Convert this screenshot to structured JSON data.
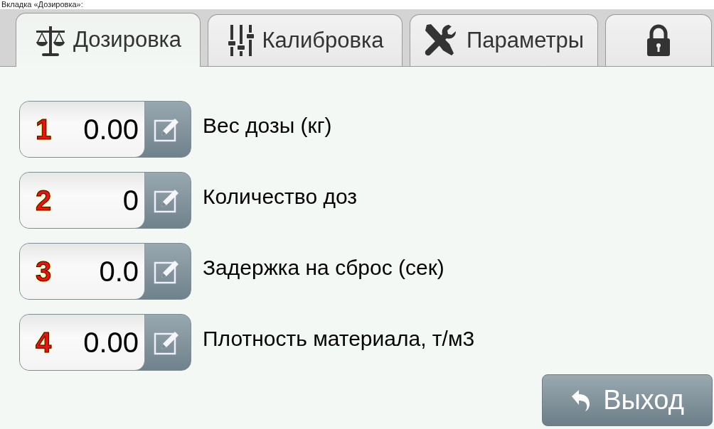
{
  "caption": "Вкладка «Дозировка»:",
  "tabs": [
    {
      "label": "Дозировка",
      "selected": true
    },
    {
      "label": "Калибровка",
      "selected": false
    },
    {
      "label": "Параметры",
      "selected": false
    },
    {
      "selected": false
    }
  ],
  "fields": [
    {
      "number": "1",
      "value": "0.00",
      "label": "Вес дозы (кг)"
    },
    {
      "number": "2",
      "value": "0",
      "label": "Количество доз"
    },
    {
      "number": "3",
      "value": "0.0",
      "label": "Задержка на сброс (сек)"
    },
    {
      "number": "4",
      "value": "0.00",
      "label": "Плотность материала, т/м3"
    }
  ],
  "exit_button": {
    "label": "Выход"
  }
}
